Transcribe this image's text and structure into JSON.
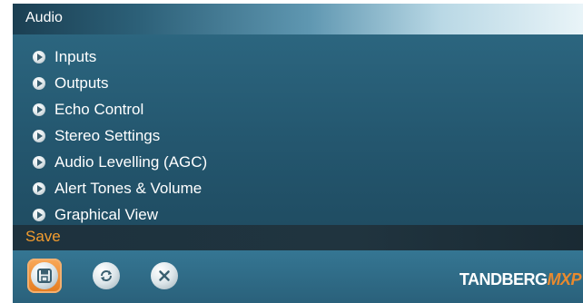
{
  "title": "Audio",
  "menu": [
    {
      "label": "Inputs"
    },
    {
      "label": "Outputs"
    },
    {
      "label": "Echo Control"
    },
    {
      "label": "Stereo Settings"
    },
    {
      "label": "Audio Levelling (AGC)"
    },
    {
      "label": "Alert Tones & Volume"
    },
    {
      "label": "Graphical View"
    }
  ],
  "save_label": "Save",
  "buttons": [
    {
      "icon": "save-icon",
      "selected": true
    },
    {
      "icon": "refresh-icon",
      "selected": false
    },
    {
      "icon": "close-icon",
      "selected": false
    }
  ],
  "brand": {
    "name": "TANDBERG",
    "model": "MXP"
  },
  "colors": {
    "accent": "#f39c2e",
    "panel": "#24576f",
    "bar": "#20343f"
  }
}
